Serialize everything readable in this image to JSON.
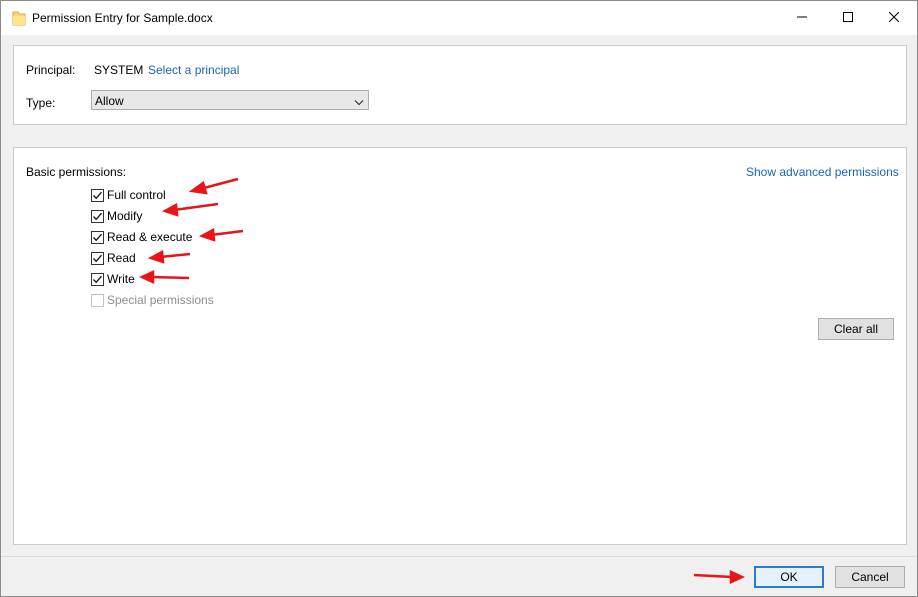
{
  "window": {
    "title": "Permission Entry for Sample.docx",
    "icon": "folder-icon",
    "controls": [
      "minimize-icon",
      "maximize-icon",
      "close-icon"
    ]
  },
  "principal": {
    "label": "Principal:",
    "value": "SYSTEM",
    "select_link": "Select a principal"
  },
  "type": {
    "label": "Type:",
    "selected": "Allow"
  },
  "permissions": {
    "heading": "Basic permissions:",
    "advanced_link": "Show advanced permissions",
    "items": [
      {
        "label": "Full control",
        "checked": true,
        "enabled": true
      },
      {
        "label": "Modify",
        "checked": true,
        "enabled": true
      },
      {
        "label": "Read & execute",
        "checked": true,
        "enabled": true
      },
      {
        "label": "Read",
        "checked": true,
        "enabled": true
      },
      {
        "label": "Write",
        "checked": true,
        "enabled": true
      },
      {
        "label": "Special permissions",
        "checked": false,
        "enabled": false
      }
    ],
    "clear_all": "Clear all"
  },
  "footer": {
    "ok": "OK",
    "cancel": "Cancel"
  },
  "colors": {
    "link": "#1a64b8",
    "annotation_arrow": "#e8141a",
    "ok_border": "#2c7ad6"
  }
}
